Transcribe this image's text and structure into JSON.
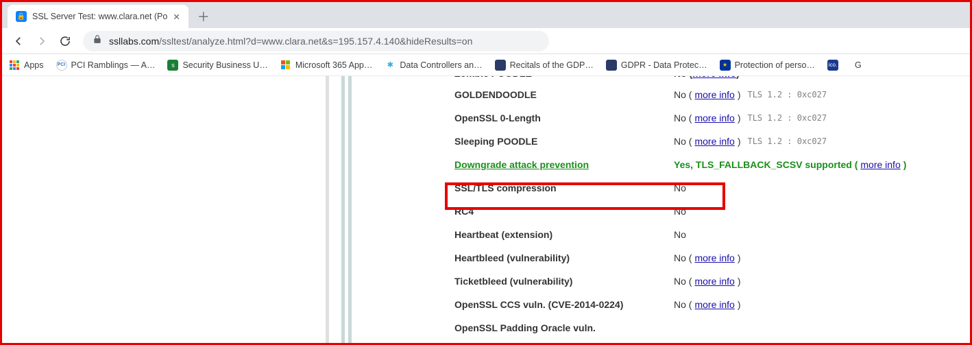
{
  "tab": {
    "title": "SSL Server Test: www.clara.net (Po"
  },
  "toolbar": {
    "url_host": "ssllabs.com",
    "url_rest": "/ssltest/analyze.html?d=www.clara.net&s=195.157.4.140&hideResults=on"
  },
  "bookmarks": [
    {
      "label": "Apps",
      "color": "#fff",
      "border": true
    },
    {
      "label": "PCI Ramblings — A…",
      "color": "#2e7dd7"
    },
    {
      "label": "Security Business U…",
      "color": "#1a7f37"
    },
    {
      "label": "Microsoft 365 App…",
      "color": "#fff",
      "ms": true
    },
    {
      "label": "Data Controllers an…",
      "color": "#8ed1fc"
    },
    {
      "label": "Recitals of the GDP…",
      "color": "#2b3a67"
    },
    {
      "label": "GDPR - Data Protec…",
      "color": "#2b3a67"
    },
    {
      "label": "Protection of perso…",
      "color": "#1a3a8f"
    },
    {
      "label": "",
      "color": "#1a3a8f",
      "cut": "ico."
    }
  ],
  "results": {
    "top_cut_label": "Zombie POODLE",
    "rows": [
      {
        "label": "GOLDENDOODLE",
        "value": "No",
        "link": "more info",
        "meta": "TLS 1.2 : 0xc027"
      },
      {
        "label": "OpenSSL 0-Length",
        "value": "No",
        "link": "more info",
        "meta": "TLS 1.2 : 0xc027"
      },
      {
        "label": "Sleeping POODLE",
        "value": "No",
        "link": "more info",
        "meta": "TLS 1.2 : 0xc027"
      },
      {
        "label": "Downgrade attack prevention",
        "value": "Yes, TLS_FALLBACK_SCSV supported",
        "link": "more info",
        "green": true
      },
      {
        "label": "SSL/TLS compression",
        "value": "No"
      },
      {
        "label": "RC4",
        "value": "No"
      },
      {
        "label": "Heartbeat (extension)",
        "value": "No"
      },
      {
        "label": "Heartbleed (vulnerability)",
        "value": "No",
        "link": "more info"
      },
      {
        "label": "Ticketbleed (vulnerability)",
        "value": "No",
        "link": "more info"
      },
      {
        "label": "OpenSSL CCS vuln. (CVE-2014-0224)",
        "value": "No",
        "link": "more info"
      },
      {
        "label": "OpenSSL Padding Oracle vuln.",
        "value": ""
      }
    ]
  },
  "links": {
    "more_info": "more info"
  }
}
